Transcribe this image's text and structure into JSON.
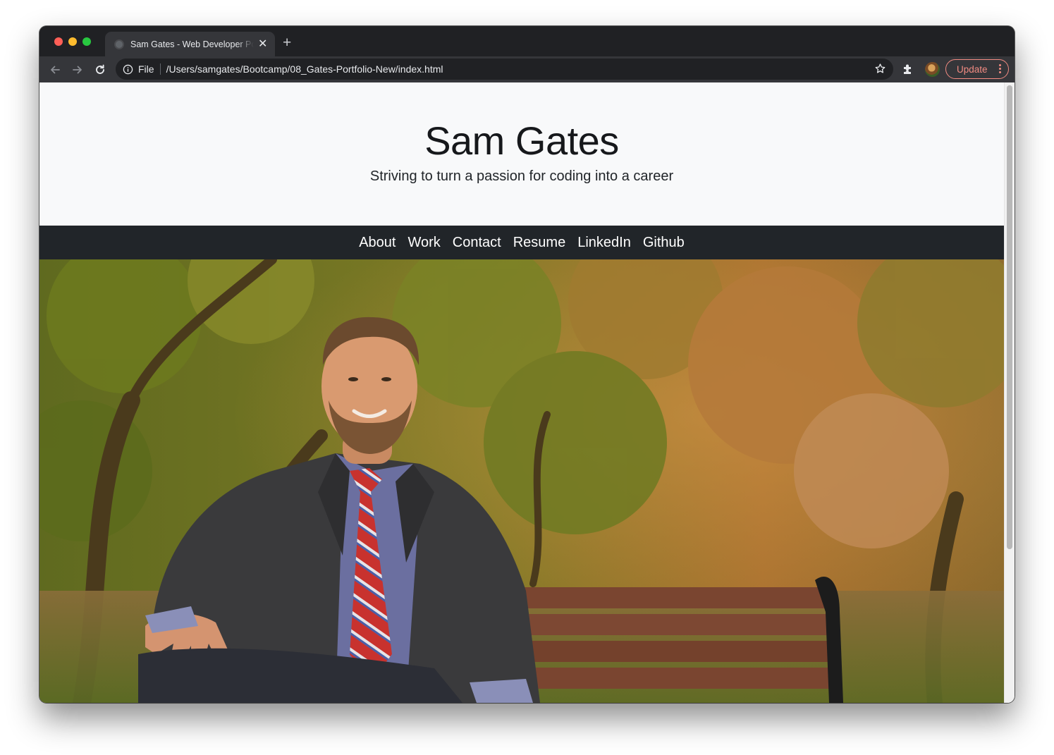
{
  "browser": {
    "tab": {
      "title": "Sam Gates - Web Developer Portfolio"
    },
    "address": {
      "scheme": "File",
      "url": "/Users/samgates/Bootcamp/08_Gates-Portfolio-New/index.html"
    },
    "update_label": "Update",
    "icons": {
      "back": "arrow-left-icon",
      "forward": "arrow-right-icon",
      "reload": "reload-icon",
      "info": "info-icon",
      "bookmark": "star-icon",
      "extensions": "puzzle-icon",
      "menu": "kebab-menu-icon"
    }
  },
  "page": {
    "title": "Sam Gates",
    "tagline": "Striving to turn a passion for coding into a career",
    "nav": [
      {
        "label": "About"
      },
      {
        "label": "Work"
      },
      {
        "label": "Contact"
      },
      {
        "label": "Resume"
      },
      {
        "label": "LinkedIn"
      },
      {
        "label": "Github"
      }
    ],
    "hero": {
      "description": "Photo of a man in a suit and red striped tie sitting on a park bench under autumn trees"
    }
  },
  "colors": {
    "browser_frame": "#202124",
    "toolbar": "#35363a",
    "header_bg": "#f8f9fa",
    "navbar_bg": "#212529",
    "update_accent": "#f28b82"
  }
}
